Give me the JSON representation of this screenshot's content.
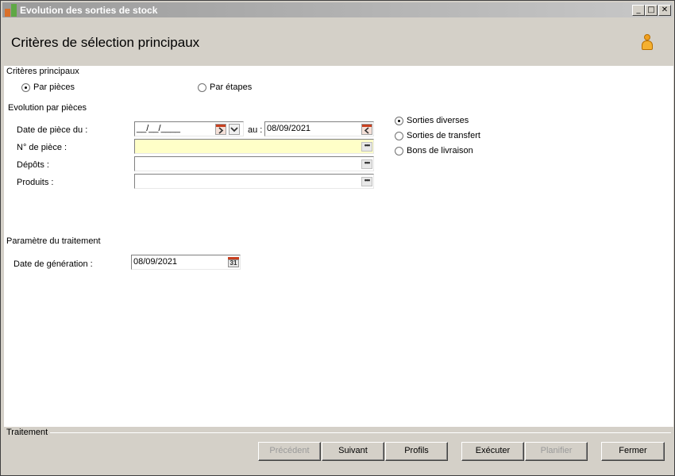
{
  "window": {
    "title": "Evolution des sorties de stock",
    "minimize": "_",
    "maximize": "□",
    "close": "✕"
  },
  "header": {
    "title": "Critères de sélection principaux",
    "icon": "user-icon"
  },
  "criteres_principaux": {
    "label": "Critères principaux",
    "options": [
      {
        "label": "Par pièces",
        "selected": true
      },
      {
        "label": "Par étapes",
        "selected": false
      }
    ]
  },
  "evolution": {
    "label": "Evolution par pièces",
    "date_label": "Date de pièce du :",
    "date_from": "__/__/____",
    "au_label": "au :",
    "date_to": "08/09/2021",
    "piece_label": "N° de pièce :",
    "piece_value": "",
    "depots_label": "Dépôts :",
    "depots_value": "",
    "produits_label": "Produits :",
    "produits_value": "",
    "dots": "•••",
    "types": [
      {
        "label": "Sorties diverses",
        "selected": true
      },
      {
        "label": "Sorties de transfert",
        "selected": false
      },
      {
        "label": "Bons de livraison",
        "selected": false
      }
    ]
  },
  "parametre": {
    "label": "Paramètre du traitement",
    "date_gen_label": "Date de génération :",
    "date_gen_value": "08/09/2021",
    "cal_day": "31"
  },
  "footer": {
    "label": "Traitement",
    "buttons": {
      "precedent": "Précédent",
      "suivant": "Suivant",
      "profils": "Profils",
      "executer": "Exécuter",
      "planifier": "Planifier",
      "fermer": "Fermer"
    }
  }
}
